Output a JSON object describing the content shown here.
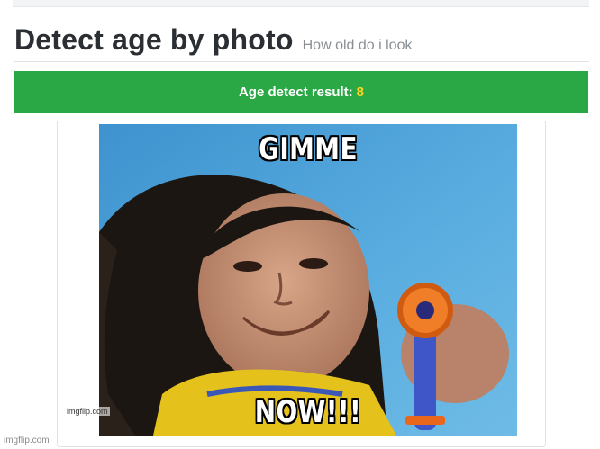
{
  "header": {
    "title": "Detect age by photo",
    "subtitle": "How old do i look"
  },
  "result": {
    "label": "Age detect result:",
    "value": "8"
  },
  "photo": {
    "top_text": "GIMME",
    "bottom_text": "NOW!!!",
    "watermark": "imgflip.com"
  },
  "footer": {
    "watermark": "imgflip.com"
  },
  "colors": {
    "result_bar": "#2aa845",
    "result_value": "#ffd51f",
    "title_text": "#2b2f33"
  }
}
